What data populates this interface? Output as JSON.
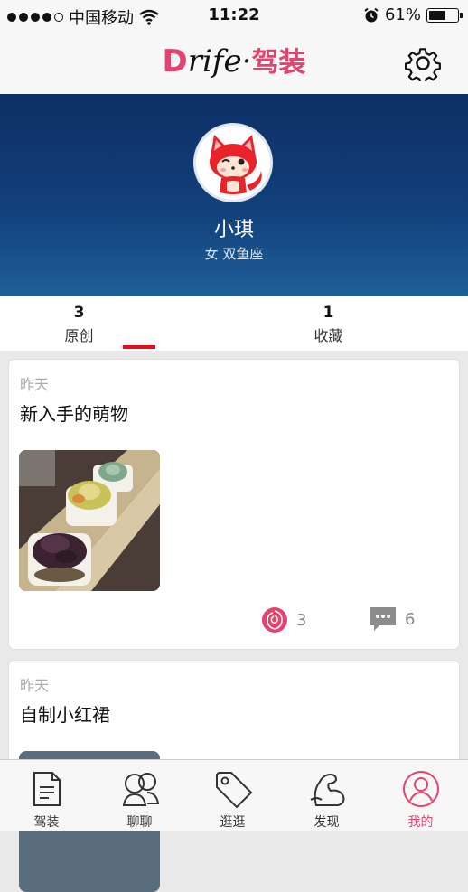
{
  "status_bar": {
    "carrier": "中国移动",
    "time": "11:22",
    "battery_percent": "61%",
    "battery_level": 0.61,
    "signal_bars_filled": 4,
    "signal_bars_total": 5
  },
  "header": {
    "logo_letter": "D",
    "logo_rest": "rife",
    "logo_sep": "·",
    "logo_cn": "驾装"
  },
  "profile": {
    "name": "小琪",
    "meta": "女 双鱼座",
    "avatar_icon": "red-fox-cartoon-avatar"
  },
  "tabs": [
    {
      "count": "3",
      "label": "原创",
      "active": true
    },
    {
      "count": "1",
      "label": "收藏",
      "active": false
    }
  ],
  "posts": [
    {
      "when": "昨天",
      "title": "新入手的萌物",
      "likes": "3",
      "comments": "6",
      "like_icon": "rose-icon",
      "comment_icon": "comment-bubble-icon"
    },
    {
      "when": "昨天",
      "title": "自制小红裙"
    }
  ],
  "nav": [
    {
      "label": "驾装",
      "icon": "document-icon",
      "active": false
    },
    {
      "label": "聊聊",
      "icon": "chat-people-icon",
      "active": false
    },
    {
      "label": "逛逛",
      "icon": "tag-icon",
      "active": false
    },
    {
      "label": "发现",
      "icon": "muscle-arm-icon",
      "active": false
    },
    {
      "label": "我的",
      "icon": "user-icon",
      "active": true
    }
  ],
  "colors": {
    "accent": "#e5426f",
    "tab_underline": "#e3101b",
    "banner_top": "#0e2f66",
    "banner_bottom": "#1e5f98"
  }
}
